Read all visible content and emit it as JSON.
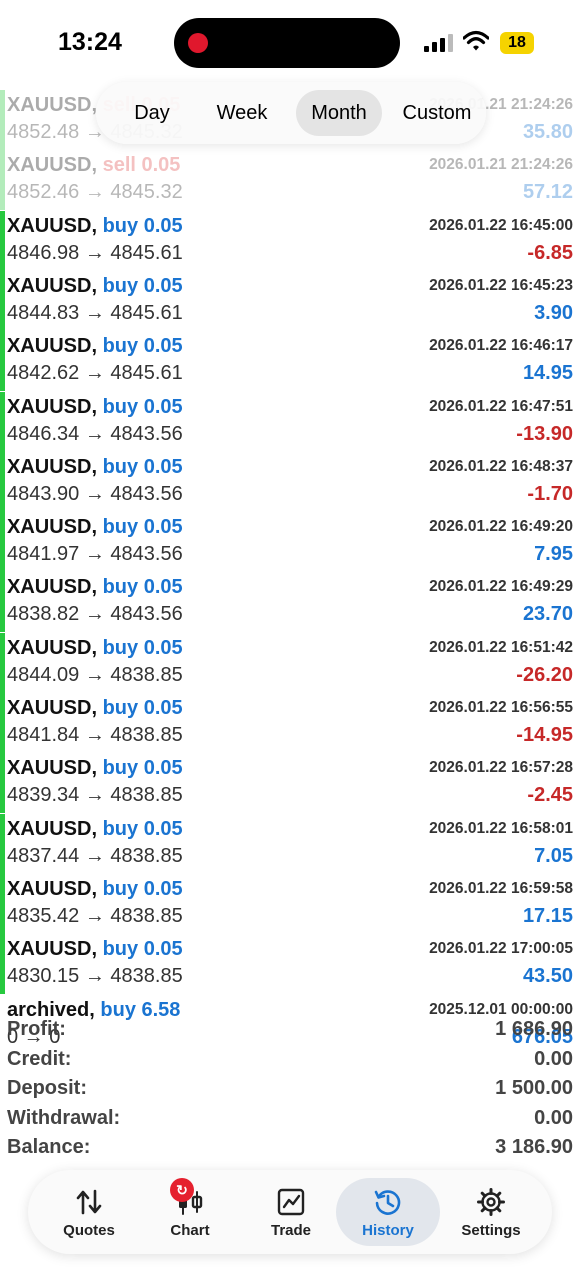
{
  "status": {
    "time": "13:24",
    "battery": "18"
  },
  "period_filter": {
    "options": [
      "Day",
      "Week",
      "Month",
      "Custom"
    ],
    "selected": "Month"
  },
  "deals": [
    {
      "symbol": "XAUUSD",
      "type": "sell 0.05",
      "date": "2026.01.21 21:24:26",
      "prices": "4852.48 → 4845.32",
      "profit": "35.80",
      "sign": "pos",
      "faded": true
    },
    {
      "symbol": "XAUUSD",
      "type": "sell 0.05",
      "date": "2026.01.21 21:24:26",
      "prices": "4852.46 → 4845.32",
      "profit": "57.12",
      "sign": "pos",
      "faded": true
    },
    {
      "symbol": "XAUUSD",
      "type": "buy 0.05",
      "date": "2026.01.22 16:45:00",
      "prices": "4846.98 → 4845.61",
      "profit": "-6.85",
      "sign": "neg"
    },
    {
      "symbol": "XAUUSD",
      "type": "buy 0.05",
      "date": "2026.01.22 16:45:23",
      "prices": "4844.83 → 4845.61",
      "profit": "3.90",
      "sign": "pos"
    },
    {
      "symbol": "XAUUSD",
      "type": "buy 0.05",
      "date": "2026.01.22 16:46:17",
      "prices": "4842.62 → 4845.61",
      "profit": "14.95",
      "sign": "pos"
    },
    {
      "symbol": "XAUUSD",
      "type": "buy 0.05",
      "date": "2026.01.22 16:47:51",
      "prices": "4846.34 → 4843.56",
      "profit": "-13.90",
      "sign": "neg"
    },
    {
      "symbol": "XAUUSD",
      "type": "buy 0.05",
      "date": "2026.01.22 16:48:37",
      "prices": "4843.90 → 4843.56",
      "profit": "-1.70",
      "sign": "neg"
    },
    {
      "symbol": "XAUUSD",
      "type": "buy 0.05",
      "date": "2026.01.22 16:49:20",
      "prices": "4841.97 → 4843.56",
      "profit": "7.95",
      "sign": "pos"
    },
    {
      "symbol": "XAUUSD",
      "type": "buy 0.05",
      "date": "2026.01.22 16:49:29",
      "prices": "4838.82 → 4843.56",
      "profit": "23.70",
      "sign": "pos"
    },
    {
      "symbol": "XAUUSD",
      "type": "buy 0.05",
      "date": "2026.01.22 16:51:42",
      "prices": "4844.09 → 4838.85",
      "profit": "-26.20",
      "sign": "neg"
    },
    {
      "symbol": "XAUUSD",
      "type": "buy 0.05",
      "date": "2026.01.22 16:56:55",
      "prices": "4841.84 → 4838.85",
      "profit": "-14.95",
      "sign": "neg"
    },
    {
      "symbol": "XAUUSD",
      "type": "buy 0.05",
      "date": "2026.01.22 16:57:28",
      "prices": "4839.34 → 4838.85",
      "profit": "-2.45",
      "sign": "neg"
    },
    {
      "symbol": "XAUUSD",
      "type": "buy 0.05",
      "date": "2026.01.22 16:58:01",
      "prices": "4837.44 → 4838.85",
      "profit": "7.05",
      "sign": "pos"
    },
    {
      "symbol": "XAUUSD",
      "type": "buy 0.05",
      "date": "2026.01.22 16:59:58",
      "prices": "4835.42 → 4838.85",
      "profit": "17.15",
      "sign": "pos"
    },
    {
      "symbol": "XAUUSD",
      "type": "buy 0.05",
      "date": "2026.01.22 17:00:05",
      "prices": "4830.15 → 4838.85",
      "profit": "43.50",
      "sign": "pos"
    },
    {
      "symbol": "archived",
      "type": "buy 6.58",
      "date": "2025.12.01 00:00:00",
      "prices": "0 → 0",
      "profit": "676.05",
      "sign": "pos",
      "archived": true
    }
  ],
  "summary": [
    {
      "label": "Profit:",
      "value": "1 686.90"
    },
    {
      "label": "Credit:",
      "value": "0.00"
    },
    {
      "label": "Deposit:",
      "value": "1 500.00"
    },
    {
      "label": "Withdrawal:",
      "value": "0.00"
    },
    {
      "label": "Balance:",
      "value": "3 186.90"
    }
  ],
  "tabs": [
    {
      "label": "Quotes",
      "icon": "quotes-icon"
    },
    {
      "label": "Chart",
      "icon": "chart-icon",
      "badge": "↻"
    },
    {
      "label": "Trade",
      "icon": "trade-icon"
    },
    {
      "label": "History",
      "icon": "history-icon",
      "active": true
    },
    {
      "label": "Settings",
      "icon": "settings-icon"
    }
  ]
}
